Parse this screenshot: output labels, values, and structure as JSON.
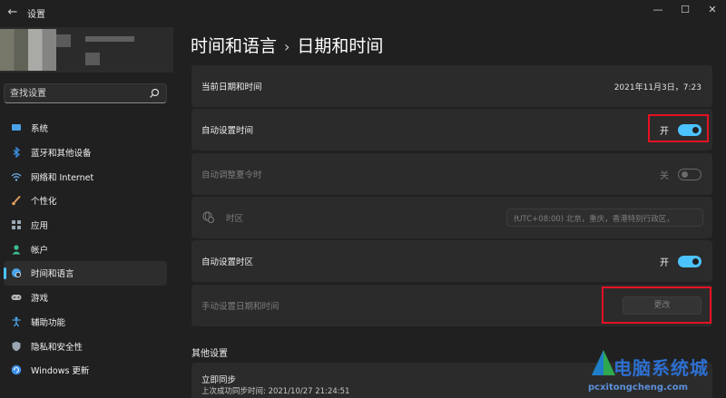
{
  "window": {
    "title": "设置",
    "back_icon": "arrow-left-icon",
    "controls": [
      "—",
      "☐",
      "✕"
    ]
  },
  "search": {
    "placeholder": "查找设置",
    "icon": "search-icon"
  },
  "sidebar": {
    "items": [
      {
        "label": "系统",
        "icon": "monitor-icon",
        "color": "#4aa3e8"
      },
      {
        "label": "蓝牙和其他设备",
        "icon": "bluetooth-icon",
        "color": "#3b8fe6"
      },
      {
        "label": "网络和 Internet",
        "icon": "wifi-icon",
        "color": "#6fb3ef"
      },
      {
        "label": "个性化",
        "icon": "brush-icon",
        "color": "#e0a060"
      },
      {
        "label": "应用",
        "icon": "apps-icon",
        "color": "#9aa6b4"
      },
      {
        "label": "帐户",
        "icon": "account-icon",
        "color": "#3fbf8f"
      },
      {
        "label": "时间和语言",
        "icon": "globe-clock-icon",
        "color": "#4aa3e8",
        "active": true
      },
      {
        "label": "游戏",
        "icon": "gamepad-icon",
        "color": "#b8b8b8"
      },
      {
        "label": "辅助功能",
        "icon": "accessibility-icon",
        "color": "#4aa3e8"
      },
      {
        "label": "隐私和安全性",
        "icon": "shield-icon",
        "color": "#9aa6b4"
      },
      {
        "label": "Windows 更新",
        "icon": "update-icon",
        "color": "#3b8fe6"
      }
    ]
  },
  "header": {
    "parent": "时间和语言",
    "separator": "›",
    "current": "日期和时间"
  },
  "settings": {
    "current_datetime_label": "当前日期和时间",
    "current_datetime_value": "2021年11月3日，7:23",
    "auto_time_label": "自动设置时间",
    "auto_time_state": "开",
    "dst_label": "自动调整夏令时",
    "dst_state": "关",
    "timezone_label": "时区",
    "timezone_value": "(UTC+08:00) 北京，重庆，香港特别行政区，",
    "auto_timezone_label": "自动设置时区",
    "auto_timezone_state": "开",
    "manual_label": "手动设置日期和时间",
    "change_button": "更改"
  },
  "other": {
    "header": "其他设置",
    "sync_title": "立即同步",
    "sync_subtitle": "上次成功同步时间: 2021/10/27 21:24:51"
  },
  "watermark": {
    "text": "电脑系统城",
    "url": "pcxitongcheng.com"
  },
  "colors": {
    "accent": "#4cc2ff",
    "highlight_box": "#e81123",
    "background": "#202020",
    "card": "#2b2b2b"
  }
}
